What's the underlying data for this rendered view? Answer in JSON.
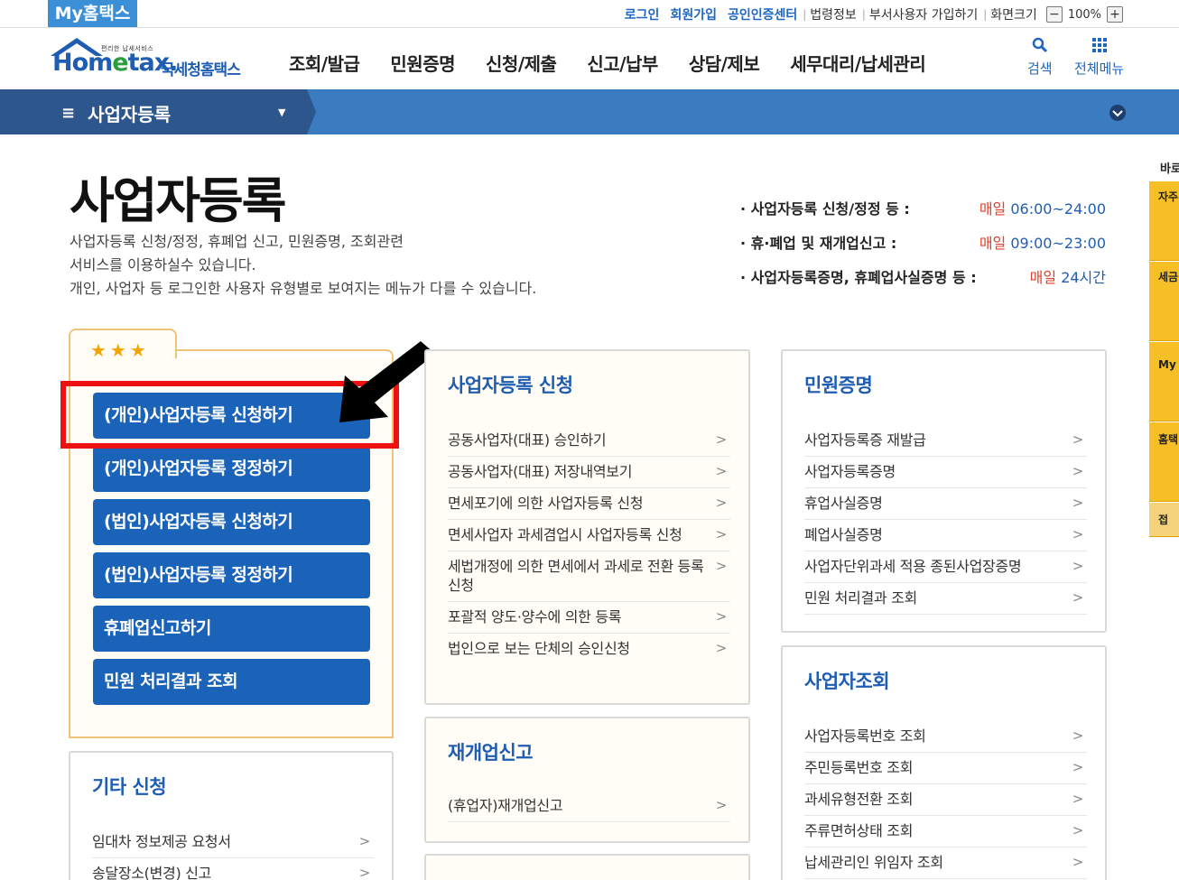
{
  "utilbar": {
    "brand": "My홈택스",
    "links_blue": [
      "로그인",
      "회원가입",
      "공인인증센터"
    ],
    "links_gray": [
      "법령정보",
      "부서사용자 가입하기",
      "화면크기"
    ],
    "zoom_minus": "−",
    "zoom_value": "100%",
    "zoom_plus": "+"
  },
  "header": {
    "logo_small": "편리한 납세서비스",
    "logo_home": "Hom",
    "logo_e": "e",
    "logo_tax": "tax.",
    "logo_kname": "국세청홈택스",
    "gnb": [
      "조회/발급",
      "민원증명",
      "신청/제출",
      "신고/납부",
      "상담/제보",
      "세무대리/납세관리"
    ],
    "search_label": "검색",
    "allmenu_label": "전체메뉴"
  },
  "locbar": {
    "current": "사업자등록",
    "ham": "≡"
  },
  "page": {
    "title": "사업자등록",
    "desc": [
      "사업자등록 신청/정정, 휴폐업 신고, 민원증명, 조회관련",
      "서비스를 이용하실수 있습니다.",
      "개인, 사업자 등 로그인한 사용자 유형별로 보여지는 메뉴가 다를 수 있습니다."
    ],
    "hours": [
      {
        "label": "· 사업자등록 신청/정정 등 :",
        "daily": "매일",
        "time": "06:00~24:00"
      },
      {
        "label": "· 휴·폐업 및 재개업신고 :",
        "daily": "매일",
        "time": "09:00~23:00"
      },
      {
        "label": "· 사업자등록증명, 휴폐업사실증명 등 :",
        "daily": "매일",
        "time": "24시간"
      }
    ]
  },
  "favorites": {
    "stars": "★★★",
    "buttons": [
      "(개인)사업자등록 신청하기",
      "(개인)사업자등록 정정하기",
      "(법인)사업자등록 신청하기",
      "(법인)사업자등록 정정하기",
      "휴폐업신고하기",
      "민원 처리결과 조회"
    ]
  },
  "cards": {
    "etc": {
      "title": "기타 신청",
      "items": [
        "임대차 정보제공 요청서",
        "송달장소(변경) 신고"
      ]
    },
    "apply": {
      "title": "사업자등록 신청",
      "items": [
        "공동사업자(대표) 승인하기",
        "공동사업자(대표) 저장내역보기",
        "면세포기에 의한 사업자등록 신청",
        "면세사업자 과세겸업시 사업자등록 신청",
        "세법개정에 의한 면세에서 과세로 전환 등록 신청",
        "포괄적 양도·양수에 의한 등록",
        "법인으로 보는 단체의 승인신청"
      ]
    },
    "reopen": {
      "title": "재개업신고",
      "items": [
        "(휴업자)재개업신고"
      ]
    },
    "certificate": {
      "title": "민원증명",
      "items": [
        "사업자등록증 재발급",
        "사업자등록증명",
        "휴업사실증명",
        "폐업사실증명",
        "사업자단위과세 적용 종된사업장증명",
        "민원 처리결과 조회"
      ]
    },
    "lookup": {
      "title": "사업자조회",
      "items": [
        "사업자등록번호 조회",
        "주민등록번호 조회",
        "과세유형전환 조회",
        "주류면허상태 조회",
        "납세관리인 위임자 조회"
      ]
    },
    "chevron": ">"
  },
  "side": {
    "top_label": "바로",
    "blocks": [
      "자주",
      "세금",
      "My",
      "홈택",
      "접"
    ]
  }
}
